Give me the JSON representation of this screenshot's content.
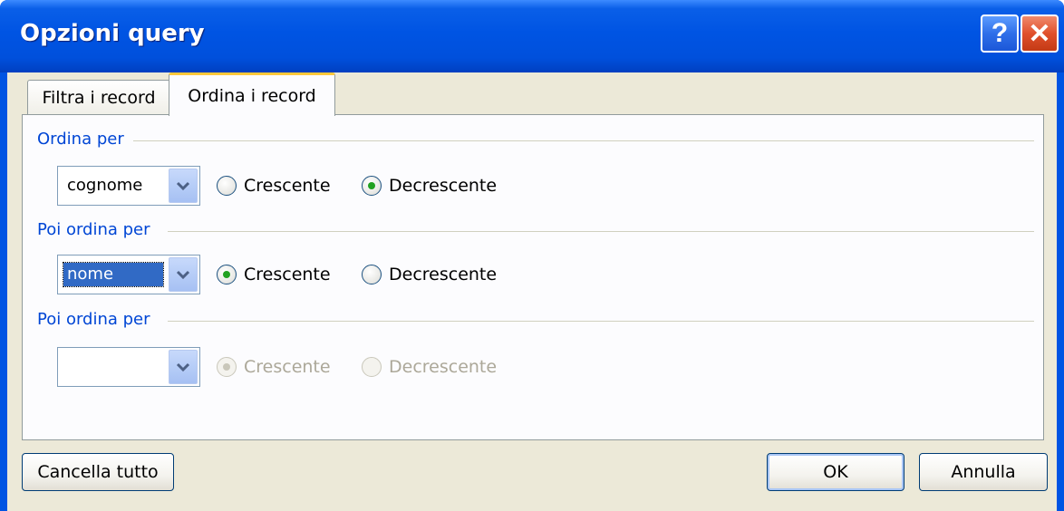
{
  "window": {
    "title": "Opzioni query"
  },
  "titlebar_buttons": {
    "help": "?",
    "close": "✕"
  },
  "tabs": [
    {
      "label": "Filtra i record",
      "active": false
    },
    {
      "label": "Ordina i record",
      "active": true
    }
  ],
  "sort_groups": [
    {
      "label": "Ordina per",
      "field_value": "cognome",
      "field_selected": false,
      "ascending_label": "Crescente",
      "descending_label": "Decrescente",
      "selected": "descending",
      "enabled": true
    },
    {
      "label": "Poi ordina per",
      "field_value": "nome",
      "field_selected": true,
      "ascending_label": "Crescente",
      "descending_label": "Decrescente",
      "selected": "ascending",
      "enabled": true
    },
    {
      "label": "Poi ordina per",
      "field_value": "",
      "field_selected": false,
      "ascending_label": "Crescente",
      "descending_label": "Decrescente",
      "selected": "ascending",
      "enabled": false
    }
  ],
  "buttons": {
    "clear_all": "Cancella tutto",
    "ok": "OK",
    "cancel": "Annulla"
  },
  "colors": {
    "title_bar": "#0054e3",
    "group_label": "#0046d5",
    "dialog_bg": "#ece9d8"
  }
}
